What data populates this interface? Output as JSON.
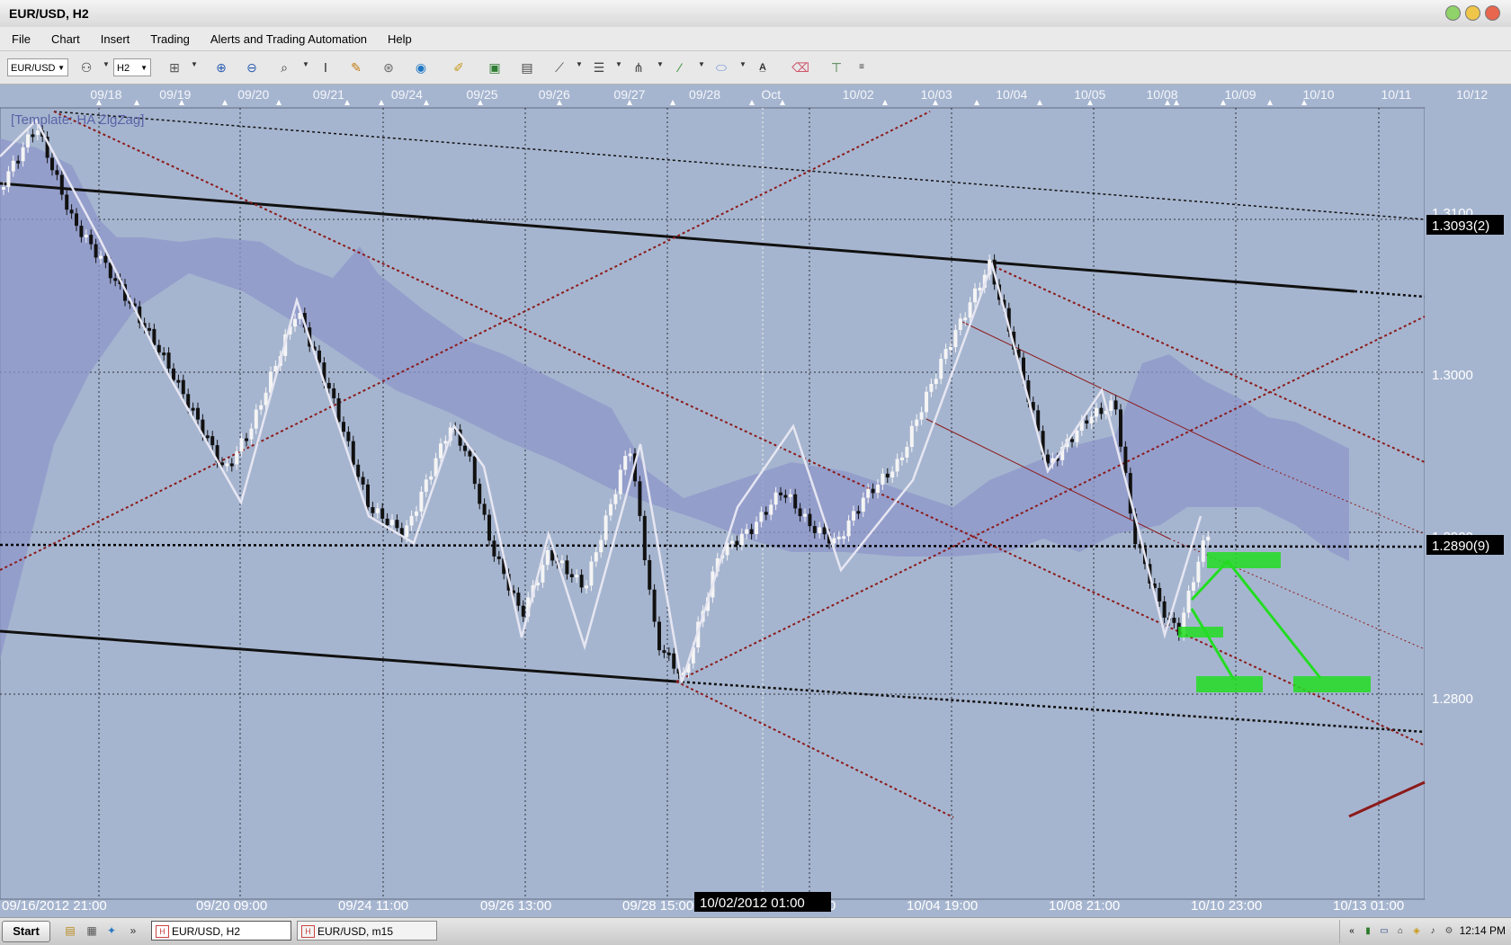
{
  "window": {
    "title": "EUR/USD, H2"
  },
  "menu": [
    "File",
    "Chart",
    "Insert",
    "Trading",
    "Alerts and Trading Automation",
    "Help"
  ],
  "toolbar": {
    "symbol": "EUR/USD",
    "timeframe": "H2"
  },
  "chart": {
    "template_label": "[Template: HA ZigZag]",
    "top_dates": [
      "09/18",
      "09/19",
      "09/20",
      "09/21",
      "09/24",
      "09/25",
      "09/26",
      "09/27",
      "09/28",
      "Oct",
      "10/02",
      "10/03",
      "10/04",
      "10/05",
      "10/08",
      "10/09",
      "10/10",
      "10/11",
      "10/12"
    ],
    "bottom_labels": [
      "09/16/2012 21:00",
      "09/20 09:00",
      "09/24 11:00",
      "09/26 13:00",
      "09/28 15:00",
      "10/02 17:00",
      "10/04 19:00",
      "10/08 21:00",
      "10/10 23:00",
      "10/13 01:00"
    ],
    "crosshair_label": "10/02/2012 01:00",
    "price_labels": [
      "1.3100",
      "1.3000",
      "1.2900",
      "1.2800"
    ],
    "price_tags": [
      "1.3093(2)",
      "1.2890(9)"
    ],
    "colors": {
      "background": "#a6b5cf",
      "cloud": "#8d97c9",
      "zigzag": "#e6e6f2",
      "projection": "#22dd22",
      "channel": "#8b1a1a"
    }
  },
  "taskbar": {
    "start": "Start",
    "tasks": [
      {
        "label": "EUR/USD, H2",
        "active": true
      },
      {
        "label": "EUR/USD, m15",
        "active": false
      }
    ],
    "clock": "12:14 PM"
  }
}
